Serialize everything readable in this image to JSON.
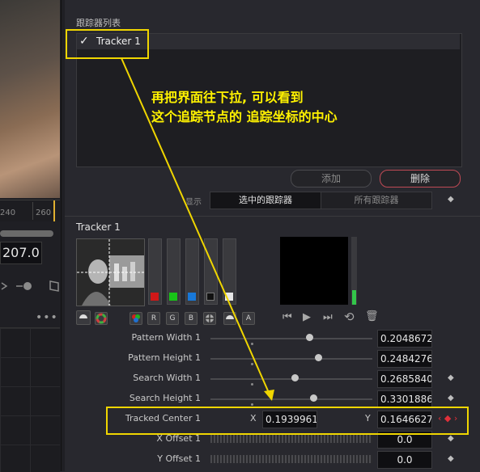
{
  "left": {
    "ruler_ticks": [
      "240",
      "260"
    ],
    "frame_value": "207.0",
    "menu": "•••"
  },
  "tracker_list": {
    "title": "跟踪器列表",
    "check": "✓",
    "items": [
      "Tracker 1"
    ],
    "add_label": "添加",
    "delete_label": "删除",
    "show_label": "显示",
    "seg_selected": "选中的跟踪器",
    "seg_all": "所有跟踪器",
    "keyframe_glyph": "◆"
  },
  "tracker": {
    "title": "Tracker 1",
    "channel_colors": [
      "#d01818",
      "#18c418",
      "#1878d8",
      "#111111",
      "#e6e6e6"
    ],
    "channel_buttons": [
      "R",
      "G",
      "B"
    ],
    "alpha_button": "A",
    "transport": {
      "prev": "⏮",
      "play": "▶",
      "next": "⏭",
      "loop": "⟲",
      "delete": "🗑"
    }
  },
  "params": [
    {
      "label": "Pattern Width 1",
      "value": "0.20486725",
      "slider": 0.62
    },
    {
      "label": "Pattern Height 1",
      "value": "0.24842767",
      "slider": 0.67
    },
    {
      "label": "Search Width 1",
      "value": "0.26858407",
      "slider": 0.52
    },
    {
      "label": "Search Height 1",
      "value": "0.33018867",
      "slider": 0.64
    }
  ],
  "tracked_center": {
    "label": "Tracked Center 1",
    "x_label": "X",
    "x_value": "0.19399615",
    "y_label": "Y",
    "y_value": "0.16466276",
    "nav": "‹ ◆ ›"
  },
  "offsets": [
    {
      "label": "X Offset 1",
      "value": "0.0"
    },
    {
      "label": "Y Offset 1",
      "value": "0.0"
    }
  ],
  "annotation": {
    "line1": "再把界面往下拉, 可以看到",
    "line2": "这个追踪节点的 追踪坐标的中心"
  },
  "colors": {
    "annotation": "#fff200",
    "delete_border": "#c04a55",
    "keyframe_red": "#e0303a"
  }
}
